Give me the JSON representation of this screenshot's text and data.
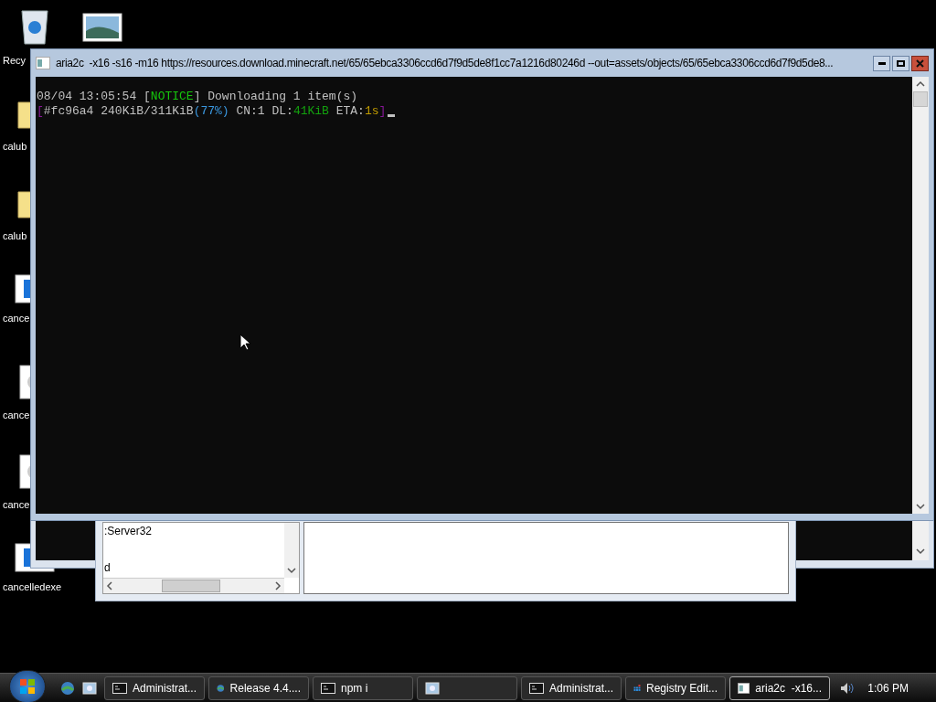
{
  "desktop_icons": [
    {
      "kind": "recycle",
      "label": "Recy"
    },
    {
      "kind": "picture"
    },
    {
      "kind": "folder",
      "label": "calub"
    },
    {
      "kind": "folder",
      "label": "calub"
    },
    {
      "kind": "app",
      "label": "cance"
    },
    {
      "kind": "gear",
      "label": "cance"
    },
    {
      "kind": "gear",
      "label": "cance"
    },
    {
      "kind": "app",
      "label": "cancelledexe"
    }
  ],
  "console_window": {
    "title": "aria2c  -x16 -s16 -m16 https://resources.download.minecraft.net/65/65ebca3306ccd6d7f9d5de8f1cc7a1216d80246d --out=assets/objects/65/65ebca3306ccd6d7f9d5de8...",
    "lines": [
      [
        {
          "text": "08/04 13:05:54 [",
          "color": "#c0c0c0"
        },
        {
          "text": "NOTICE",
          "color": "#16c60c"
        },
        {
          "text": "] Downloading 1 item(s)",
          "color": "#c0c0c0"
        }
      ],
      [
        {
          "text": "[",
          "color": "#881798"
        },
        {
          "text": "#fc96a4 240KiB/311KiB",
          "color": "#c0c0c0"
        },
        {
          "text": "(77%)",
          "color": "#3a96dd"
        },
        {
          "text": " CN:1 DL:",
          "color": "#c0c0c0"
        },
        {
          "text": "41KiB",
          "color": "#13a10e"
        },
        {
          "text": " ETA:",
          "color": "#c0c0c0"
        },
        {
          "text": "1s",
          "color": "#c19c00"
        },
        {
          "text": "]",
          "color": "#881798"
        }
      ]
    ]
  },
  "registry_window": {
    "left_pane": [
      ":Server32",
      "d"
    ]
  },
  "taskbar": {
    "tasks": [
      {
        "kind": "console",
        "label": "Administrat...",
        "selected": false
      },
      {
        "kind": "globe",
        "label": "Release 4.4....",
        "selected": false
      },
      {
        "kind": "console",
        "label": "npm i",
        "selected": false
      },
      {
        "kind": "photo",
        "selected": false
      },
      {
        "kind": "console",
        "label": "Administrat...",
        "selected": false
      },
      {
        "kind": "registry",
        "label": "Registry Edit...",
        "selected": false
      },
      {
        "kind": "window",
        "label": "aria2c  -x16...",
        "selected": true
      }
    ],
    "clock": "1:06 PM"
  }
}
